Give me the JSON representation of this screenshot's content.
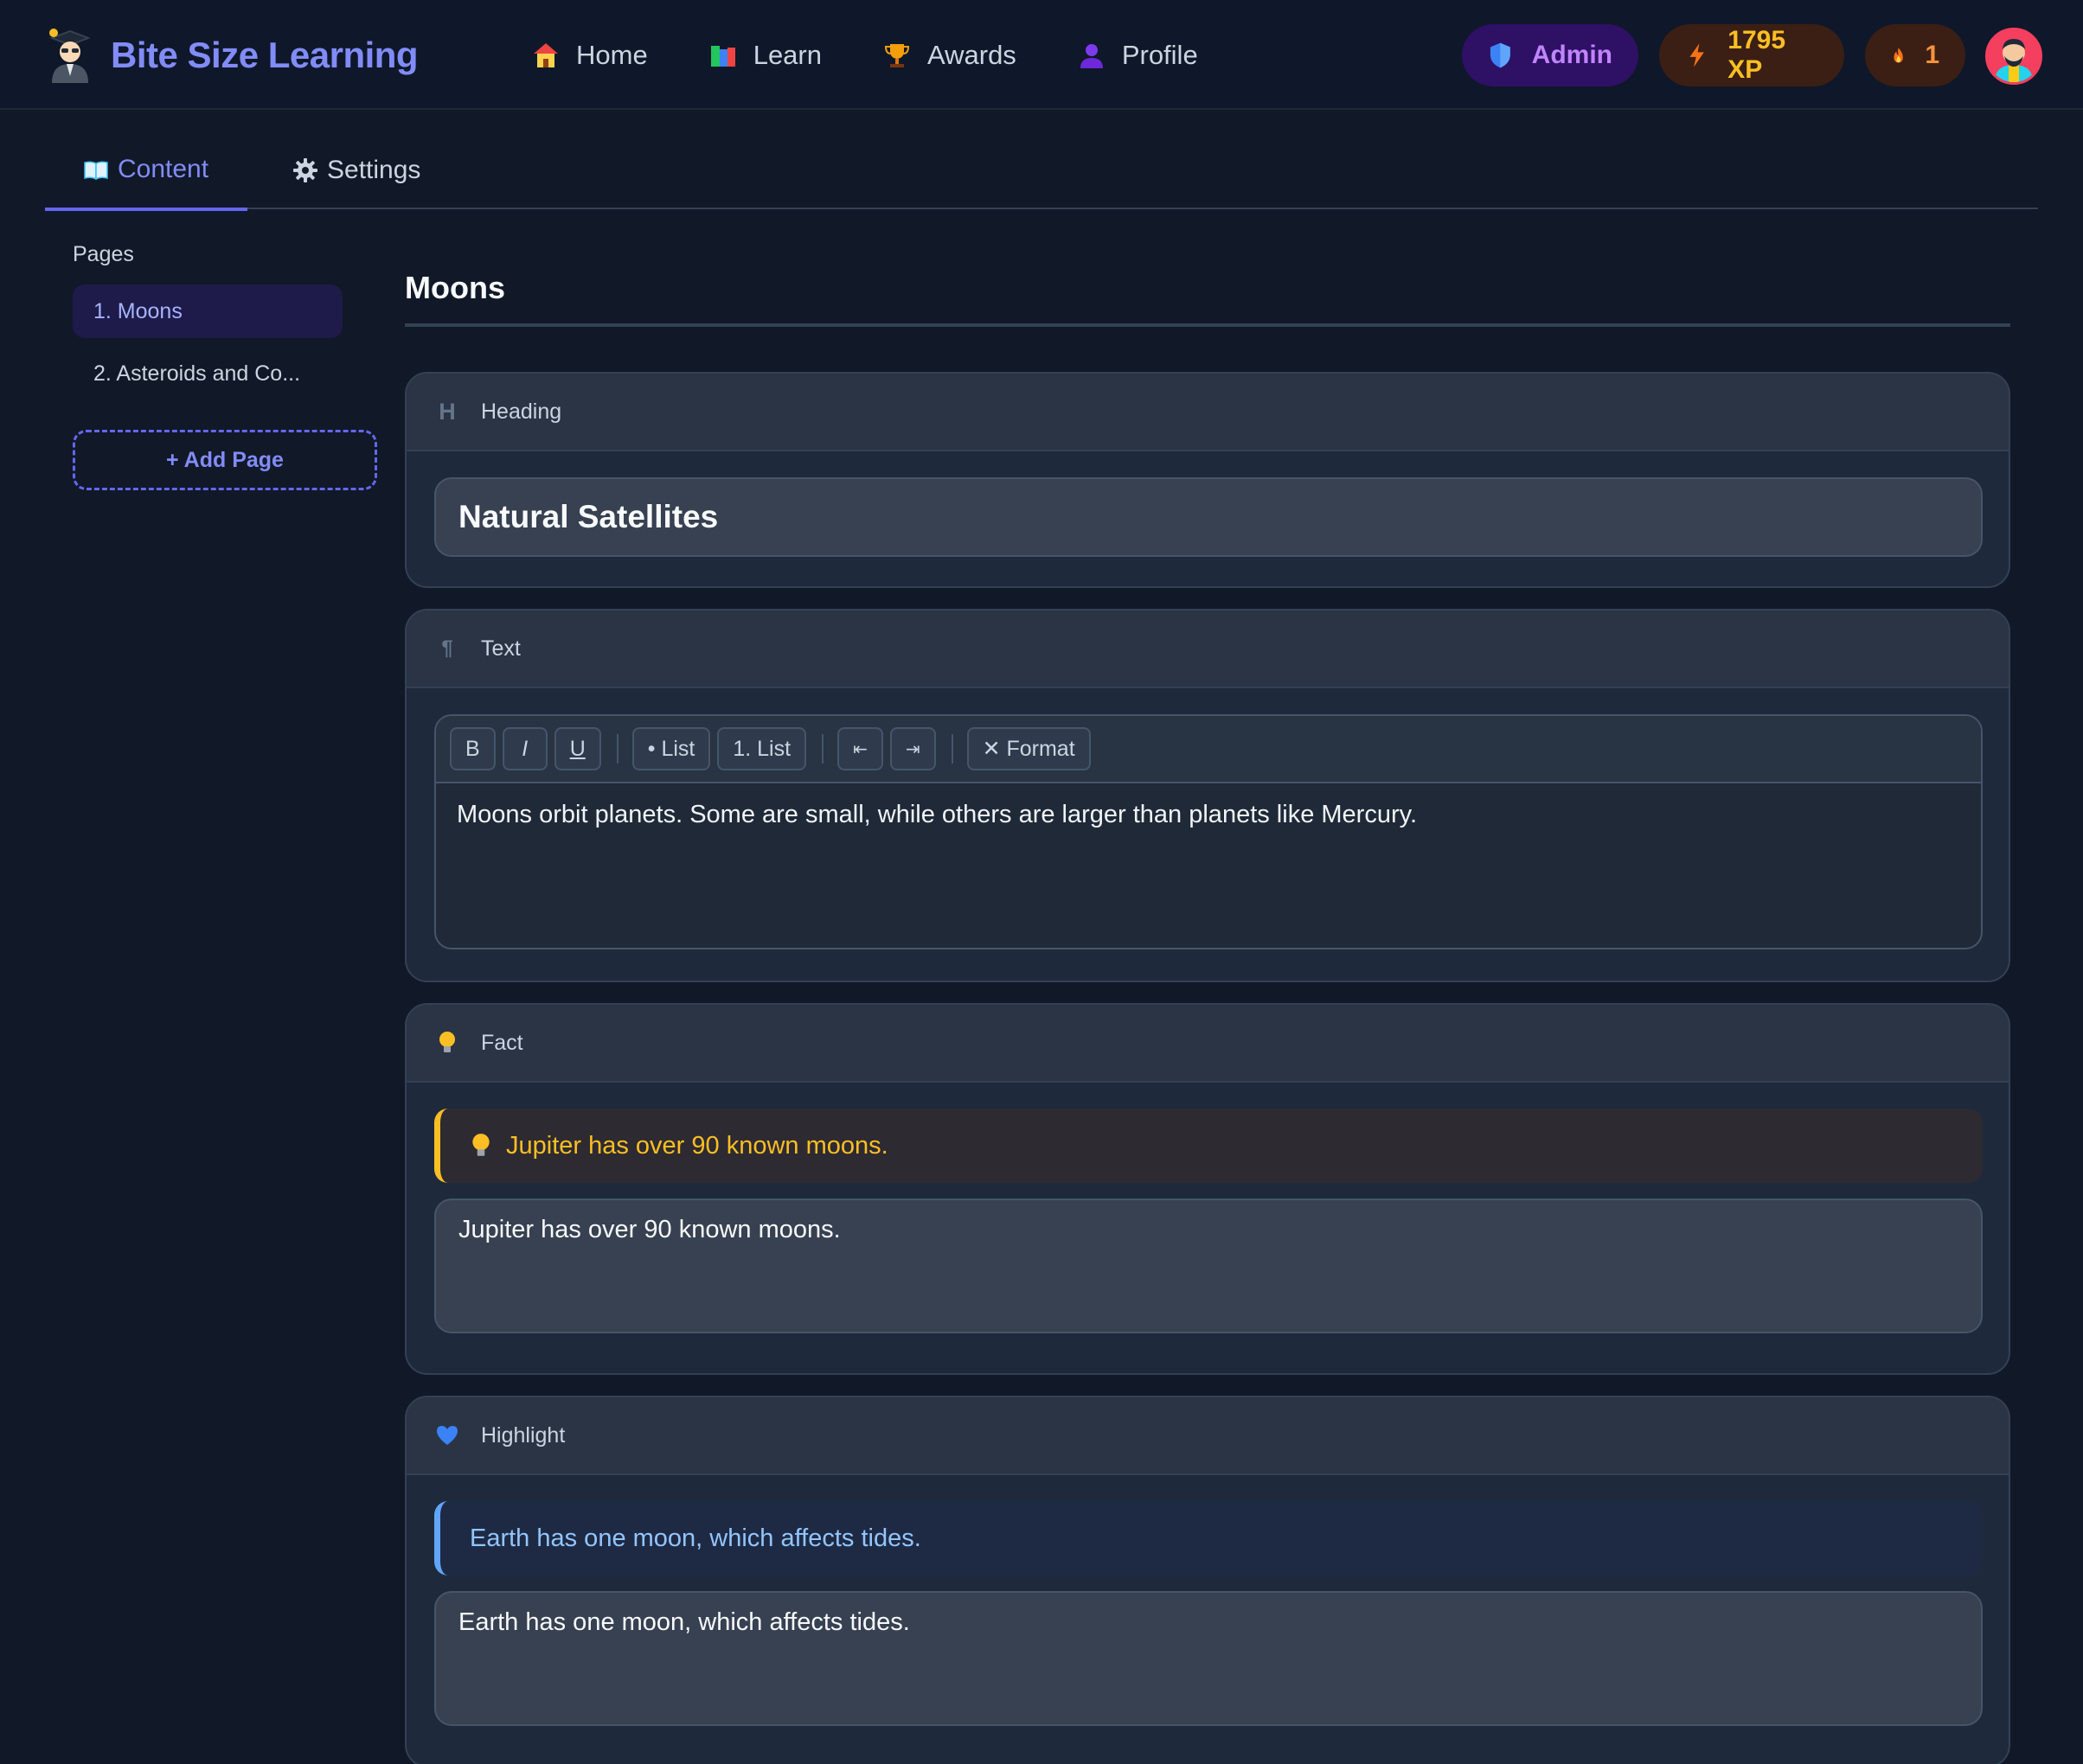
{
  "app": {
    "brand_name": "Bite Size Learning"
  },
  "nav": {
    "items": [
      {
        "label": "Home",
        "icon": "house-icon"
      },
      {
        "label": "Learn",
        "icon": "books-icon"
      },
      {
        "label": "Awards",
        "icon": "trophy-icon"
      },
      {
        "label": "Profile",
        "icon": "person-icon"
      }
    ]
  },
  "header": {
    "admin_label": "Admin",
    "xp_label": "1795 XP",
    "streak_label": "1"
  },
  "tabs": {
    "content_label": "Content",
    "settings_label": "Settings"
  },
  "sidebar": {
    "title": "Pages",
    "pages": [
      {
        "label": "1. Moons",
        "active": true
      },
      {
        "label": "2. Asteroids and Co...",
        "active": false
      }
    ],
    "add_page_label": "+ Add Page"
  },
  "main": {
    "page_title": "Moons",
    "blocks": {
      "heading": {
        "type_label": "Heading",
        "icon_glyph": "H",
        "value": "Natural Satellites"
      },
      "text": {
        "type_label": "Text",
        "icon_glyph": "¶",
        "toolbar": {
          "bold": "B",
          "italic": "I",
          "underline": "U",
          "bullet_list": "• List",
          "numbered_list": "1. List",
          "outdent": "⇤",
          "indent": "⇥",
          "clear_format": "✕ Format"
        },
        "value": "Moons orbit planets. Some are small, while others are larger than planets like Mercury."
      },
      "fact": {
        "type_label": "Fact",
        "preview": "Jupiter has over 90 known moons.",
        "value": "Jupiter has over 90 known moons."
      },
      "highlight": {
        "type_label": "Highlight",
        "preview": "Earth has one moon, which affects tides.",
        "value": "Earth has one moon, which affects tides."
      }
    }
  },
  "colors": {
    "background": "#111827",
    "accent": "#6366f1",
    "brand": "#818cf8",
    "xp": "#fbbf24",
    "admin": "#c084fc",
    "fact_border": "#fbbf24",
    "highlight_border": "#60a5fa"
  }
}
